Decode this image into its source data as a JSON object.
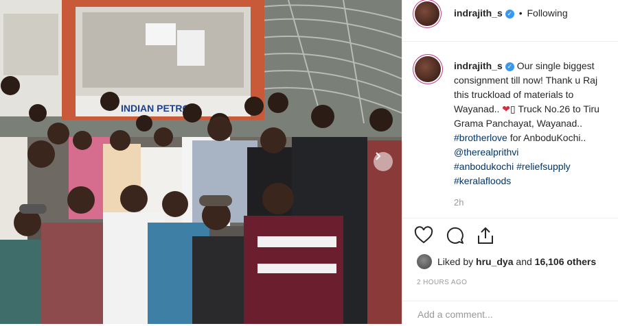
{
  "post": {
    "username": "indrajith_s",
    "follow_state": "Following",
    "separator": "•",
    "verified_mark": "✓",
    "verified_icon": "verified-badge-icon",
    "caption": {
      "line1_text": "Our single biggest",
      "line2_text": "consignment till now! Thank u Raj",
      "line3_text": "this truckload of materials to",
      "line4_pre": "Wayanad..",
      "line4_post": "Truck No.26 to Tiru",
      "line5_text": "Grama Panchayat, Wayanad..",
      "line6_tag": "#brotherlove",
      "line6_post": "for AnboduKochi..",
      "line7_tag": "@therealprithvi",
      "line8_tag1": "#anbodukochi",
      "line8_tag2": "#reliefsupply",
      "line9_tag": "#keralafloods",
      "heart_glyph": "❤",
      "box_glyph": "▯"
    },
    "time_ago": "2h",
    "likes": {
      "prefix": "Liked by",
      "user": "hru_dya",
      "middle": "and",
      "others": "16,106 others"
    },
    "posted_time": "2 HOURS AGO",
    "comment_placeholder": "Add a comment...",
    "photo_sign_text": "INDIAN PETRO",
    "icons": [
      "heart-icon",
      "comment-icon",
      "share-icon",
      "chevron-right-icon"
    ],
    "colors": {
      "link": "#003569",
      "verified": "#3897f0",
      "muted": "#999999",
      "heart": "#d92e3f"
    }
  }
}
